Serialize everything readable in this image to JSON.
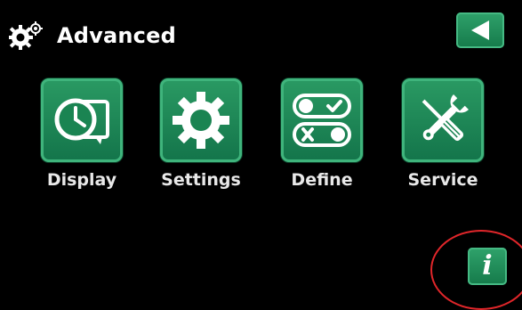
{
  "header": {
    "title": "Advanced",
    "icon": "gears-icon",
    "back_icon": "back-arrow-icon"
  },
  "tiles": [
    {
      "label": "Display",
      "icon": "clock-display-icon"
    },
    {
      "label": "Settings",
      "icon": "gear-icon"
    },
    {
      "label": "Define",
      "icon": "toggle-switches-icon"
    },
    {
      "label": "Service",
      "icon": "tools-icon"
    }
  ],
  "info": {
    "label": "i",
    "icon": "info-icon"
  },
  "colors": {
    "background": "#000000",
    "tile_green": "#1f8a57",
    "tile_border": "#3fb47c",
    "text": "#ffffff",
    "highlight": "#e0262a"
  }
}
